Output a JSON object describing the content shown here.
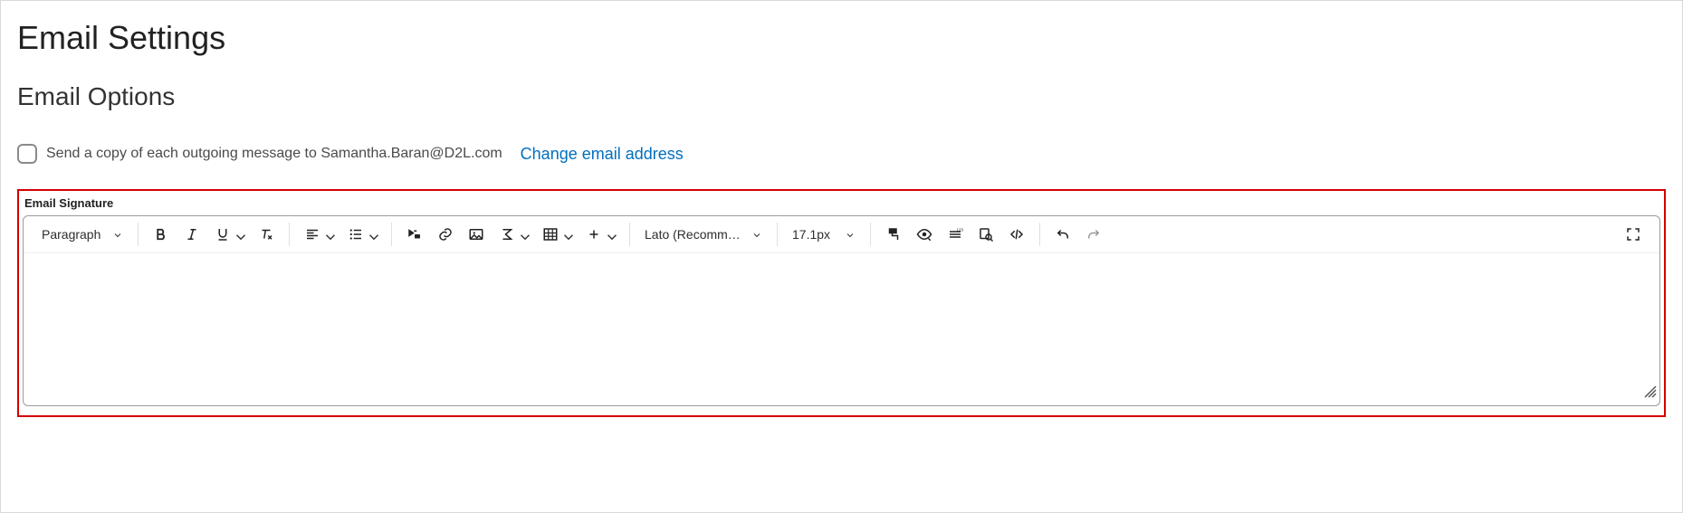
{
  "page": {
    "title": "Email Settings",
    "section_title": "Email Options"
  },
  "option": {
    "send_copy_label": "Send a copy of each outgoing message to Samantha.Baran@D2L.com",
    "change_email_link": "Change email address"
  },
  "signature": {
    "label": "Email Signature"
  },
  "toolbar": {
    "block_format": "Paragraph",
    "font_family": "Lato (Recomm…",
    "font_size": "17.1px"
  }
}
